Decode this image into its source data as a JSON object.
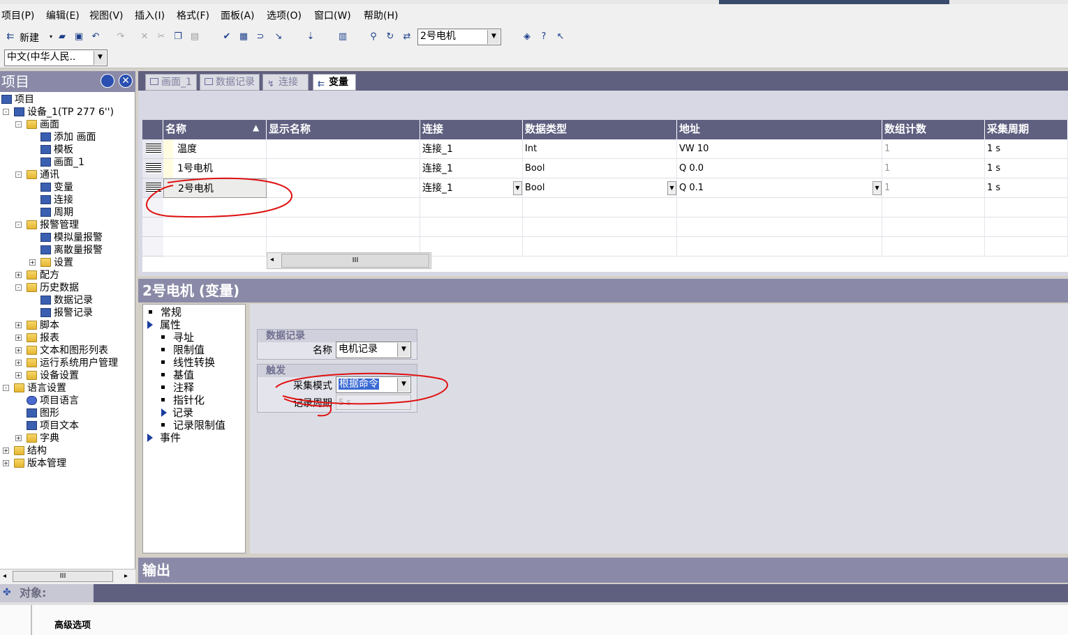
{
  "menu": {
    "items": [
      "项目(P)",
      "编辑(E)",
      "视图(V)",
      "插入(I)",
      "格式(F)",
      "面板(A)",
      "选项(O)",
      "窗口(W)",
      "帮助(H)"
    ]
  },
  "toolbar": {
    "new_label": "新建",
    "object_combo_value": "2号电机",
    "language_combo_value": "中文(中华人民.."
  },
  "project_panel": {
    "title": "项目",
    "tree": [
      {
        "label": "项目",
        "icon": "project-icon"
      },
      {
        "label": "设备_1(TP 277 6'')",
        "icon": "device-icon"
      },
      {
        "label": "画面",
        "icon": "folder-icon"
      },
      {
        "label": "添加 画面",
        "icon": "add-screen-icon"
      },
      {
        "label": "模板",
        "icon": "template-icon"
      },
      {
        "label": "画面_1",
        "icon": "screen-icon"
      },
      {
        "label": "通讯",
        "icon": "folder-icon"
      },
      {
        "label": "变量",
        "icon": "tag-icon"
      },
      {
        "label": "连接",
        "icon": "connection-icon"
      },
      {
        "label": "周期",
        "icon": "cycle-icon"
      },
      {
        "label": "报警管理",
        "icon": "folder-icon"
      },
      {
        "label": "模拟量报警",
        "icon": "analog-alarm-icon"
      },
      {
        "label": "离散量报警",
        "icon": "discrete-alarm-icon"
      },
      {
        "label": "设置",
        "icon": "folder-icon"
      },
      {
        "label": "配方",
        "icon": "folder-icon"
      },
      {
        "label": "历史数据",
        "icon": "folder-icon"
      },
      {
        "label": "数据记录",
        "icon": "data-log-icon"
      },
      {
        "label": "报警记录",
        "icon": "alarm-log-icon"
      },
      {
        "label": "脚本",
        "icon": "folder-icon"
      },
      {
        "label": "报表",
        "icon": "folder-icon"
      },
      {
        "label": "文本和图形列表",
        "icon": "folder-icon"
      },
      {
        "label": "运行系统用户管理",
        "icon": "folder-icon"
      },
      {
        "label": "设备设置",
        "icon": "folder-icon"
      },
      {
        "label": "语言设置",
        "icon": "folder-icon"
      },
      {
        "label": "项目语言",
        "icon": "globe-icon"
      },
      {
        "label": "图形",
        "icon": "graphic-icon"
      },
      {
        "label": "项目文本",
        "icon": "text-icon"
      },
      {
        "label": "字典",
        "icon": "folder-icon"
      },
      {
        "label": "结构",
        "icon": "folder-icon"
      },
      {
        "label": "版本管理",
        "icon": "folder-icon"
      }
    ]
  },
  "tabs": [
    "画面_1",
    "数据记录",
    "连接",
    "变量"
  ],
  "tag_table": {
    "columns": [
      "名称",
      "显示名称",
      "连接",
      "数据类型",
      "地址",
      "数组计数",
      "采集周期"
    ],
    "rows": [
      {
        "name": "温度",
        "display": "",
        "connection": "连接_1",
        "type": "Int",
        "address": "VW 10",
        "count": "1",
        "cycle": "1 s"
      },
      {
        "name": "1号电机",
        "display": "",
        "connection": "连接_1",
        "type": "Bool",
        "address": "Q 0.0",
        "count": "1",
        "cycle": "1 s"
      },
      {
        "name": "2号电机",
        "display": "",
        "connection": "连接_1",
        "type": "Bool",
        "address": "Q 0.1",
        "count": "1",
        "cycle": "1 s"
      }
    ],
    "scroll_thumb": "III"
  },
  "properties": {
    "title": "2号电机 (变量)",
    "nav": [
      {
        "label": "常规",
        "kind": "bullet"
      },
      {
        "label": "属性",
        "kind": "expanded"
      },
      {
        "label": "寻址",
        "kind": "bullet"
      },
      {
        "label": "限制值",
        "kind": "bullet"
      },
      {
        "label": "线性转换",
        "kind": "bullet"
      },
      {
        "label": "基值",
        "kind": "bullet"
      },
      {
        "label": "注释",
        "kind": "bullet"
      },
      {
        "label": "指针化",
        "kind": "bullet"
      },
      {
        "label": "记录",
        "kind": "selected"
      },
      {
        "label": "记录限制值",
        "kind": "bullet"
      },
      {
        "label": "事件",
        "kind": "expanded"
      }
    ],
    "data_log_group": "数据记录",
    "name_label": "名称",
    "name_value": "电机记录",
    "trigger_group": "触发",
    "mode_label": "采集模式",
    "mode_value": "根据命令",
    "period_label": "记录周期",
    "period_value": "5 s"
  },
  "output": {
    "title": "输出"
  },
  "object_bar": {
    "label": "对象:"
  },
  "bottom": {
    "label": "高级选项"
  },
  "colors": {
    "header_bar": "#8a8aa8",
    "grid_header": "#5f6080",
    "annotation": "#e01010"
  }
}
